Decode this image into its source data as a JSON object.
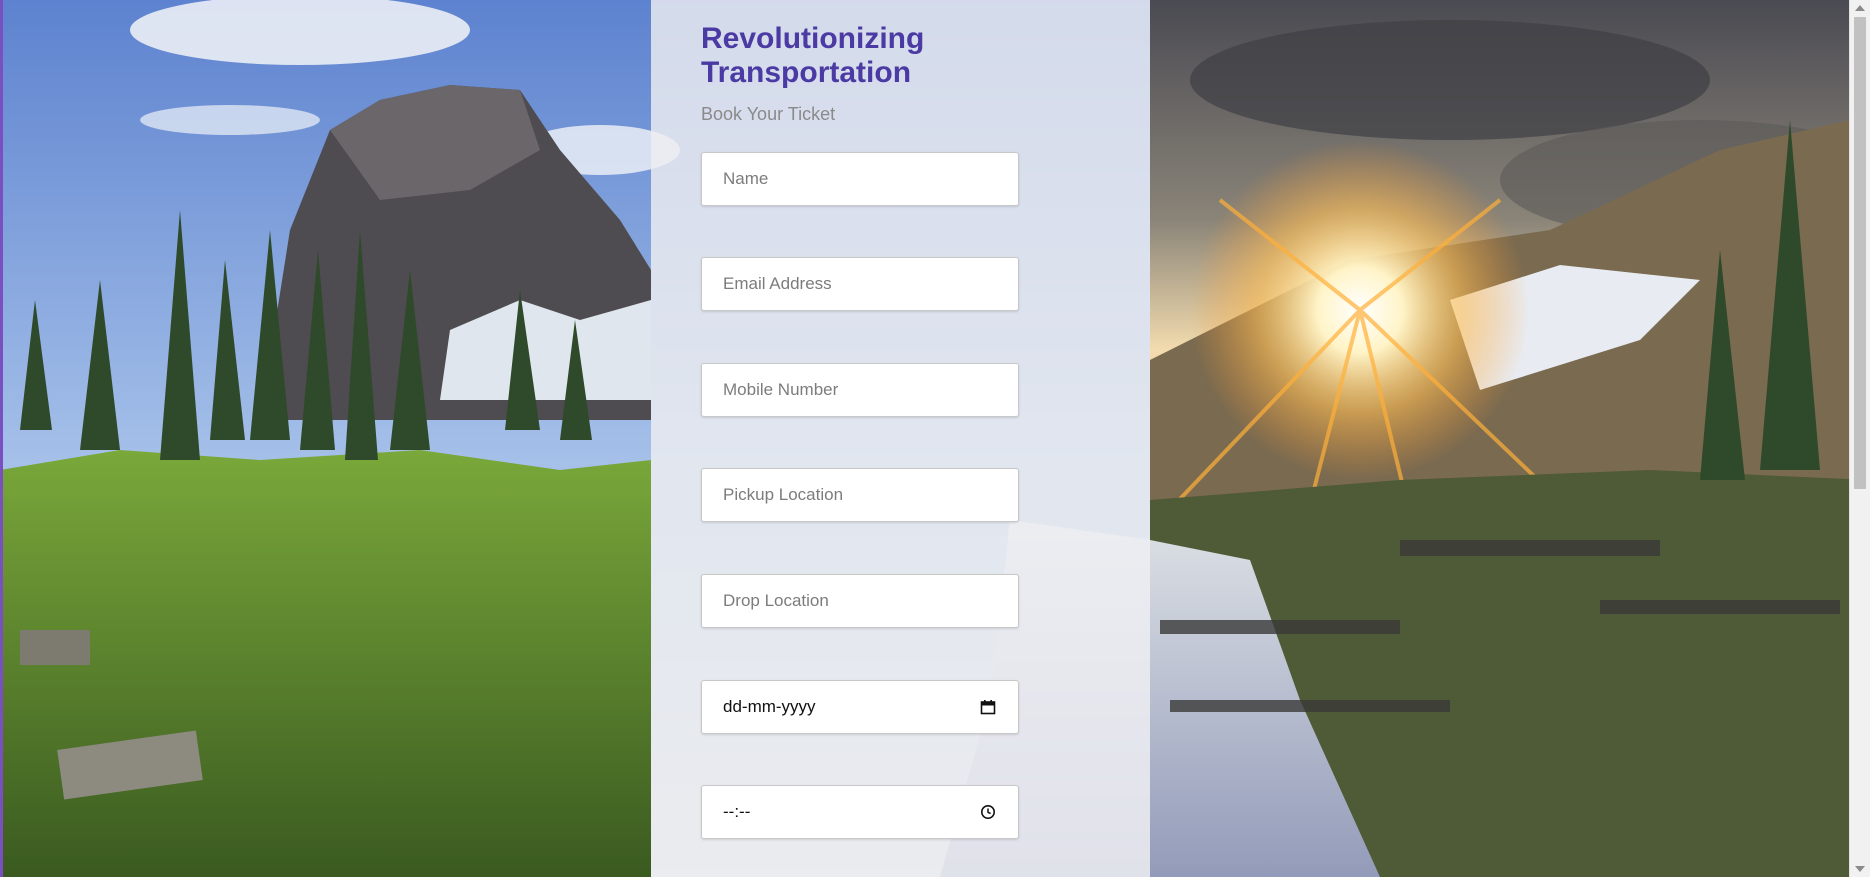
{
  "form": {
    "title": "Revolutionizing Transportation",
    "subtitle": "Book Your Ticket",
    "fields": [
      {
        "name": "name",
        "placeholder": "Name"
      },
      {
        "name": "email",
        "placeholder": "Email Address"
      },
      {
        "name": "mobile",
        "placeholder": "Mobile Number"
      },
      {
        "name": "pickup",
        "placeholder": "Pickup Location"
      },
      {
        "name": "drop",
        "placeholder": "Drop Location"
      }
    ],
    "date_field": {
      "display": "dd-mm-yyyy",
      "icon": "calendar-icon"
    },
    "time_field": {
      "display": "--:--",
      "icon": "clock-icon"
    }
  },
  "colors": {
    "title": "#4b3aa3",
    "subtitle": "#8a8a8a",
    "panel": "#eeeef0"
  }
}
